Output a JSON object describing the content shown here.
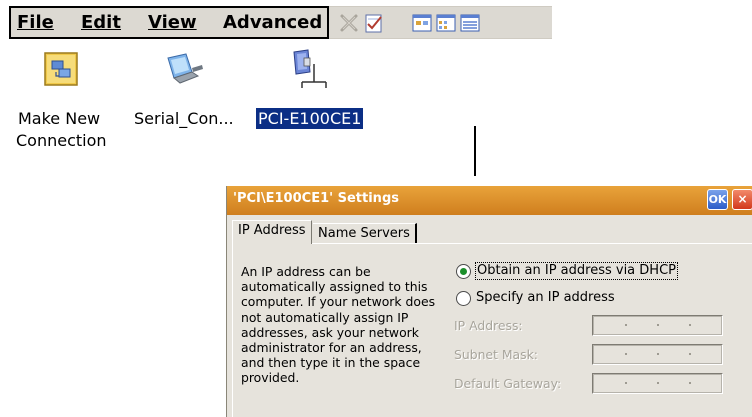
{
  "menu": {
    "file": "File",
    "edit": "Edit",
    "view": "View",
    "advanced": "Advanced"
  },
  "toolbar": {
    "icons": [
      "delete-icon",
      "properties-icon",
      "large-icons-view-icon",
      "small-icons-view-icon",
      "details-view-icon"
    ]
  },
  "desktop": {
    "items": [
      {
        "label_line1": "Make New",
        "label_line2": "Connection",
        "icon": "make-new-connection-icon"
      },
      {
        "label": "Serial_Con...",
        "icon": "serial-connection-icon"
      },
      {
        "label": "PCI-E100CE1",
        "icon": "network-adapter-icon",
        "selected": true
      }
    ]
  },
  "dialog": {
    "title": "'PCI\\E100CE1' Settings",
    "ok_label": "OK",
    "close_label": "×",
    "tabs": [
      {
        "label": "IP Address",
        "active": true
      },
      {
        "label": "Name Servers",
        "active": false
      }
    ],
    "description": "An IP address can be automatically assigned to this computer.  If your network does not automatically assign IP addresses, ask your network administrator for an address, and then type it in the space provided.",
    "radio_dhcp": "Obtain an IP address via DHCP",
    "radio_specify": "Specify an IP address",
    "selected_option": "dhcp",
    "fields": {
      "ip_address": "IP Address:",
      "subnet_mask": "Subnet Mask:",
      "default_gateway": "Default Gateway:"
    }
  },
  "colors": {
    "titlebar": "#e09232",
    "selection": "#0b2e85",
    "radio_dot": "#1c8f2b",
    "menubar": "#dcd9d2"
  }
}
